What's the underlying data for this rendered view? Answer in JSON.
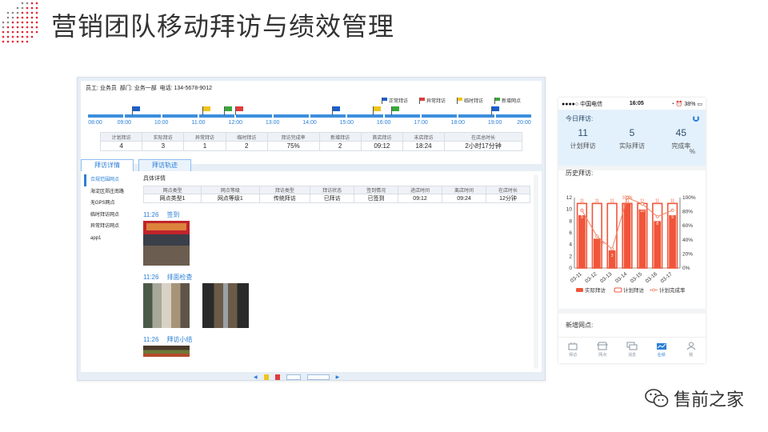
{
  "slide": {
    "title": "营销团队移动拜访与绩效管理",
    "brand": "售前之家"
  },
  "desktop": {
    "employee": {
      "label_employee": "员工:",
      "employee": "业务员",
      "label_dept": "部门:",
      "dept": "业务一部",
      "label_phone": "电话:",
      "phone": "134-5678-9012"
    },
    "legend": [
      {
        "label": "正常拜访",
        "color": "#1a5fc9"
      },
      {
        "label": "异常拜访",
        "color": "#e23b3b"
      },
      {
        "label": "临时拜访",
        "color": "#f0c419"
      },
      {
        "label": "新增网点",
        "color": "#3aa83a"
      }
    ],
    "timeline": {
      "labels": [
        "08:00",
        "09:00",
        "10:00",
        "11:00",
        "12:00",
        "13:00",
        "14:00",
        "15:00",
        "16:00",
        "17:00",
        "18:00",
        "19:00",
        "20:00"
      ],
      "flags": [
        {
          "hour": 9.2,
          "color": "#1a5fc9"
        },
        {
          "hour": 11.1,
          "color": "#f0c419"
        },
        {
          "hour": 11.7,
          "color": "#3aa83a"
        },
        {
          "hour": 12.0,
          "color": "#e23b3b"
        },
        {
          "hour": 14.6,
          "color": "#1a5fc9"
        },
        {
          "hour": 15.7,
          "color": "#f0c419"
        },
        {
          "hour": 16.2,
          "color": "#3aa83a"
        },
        {
          "hour": 18.9,
          "color": "#1a5fc9"
        }
      ]
    },
    "stats": {
      "headers": [
        "计划拜访",
        "实际拜访",
        "异常拜访",
        "临时拜访",
        "拜访完成率",
        "新增拜访",
        "首店拜访",
        "末店拜访",
        "在店总时长"
      ],
      "values": [
        "4",
        "3",
        "1",
        "2",
        "75%",
        "2",
        "09:12",
        "18:24",
        "2小时17分钟"
      ]
    },
    "tabs": [
      "拜访详情",
      "拜访轨迹"
    ],
    "side_items": [
      "合规范围网点",
      "海淀区郑庄南路",
      "无GPS网点",
      "临时拜访网点",
      "异常拜访网点",
      "app1"
    ],
    "detail": {
      "label": "具体详情",
      "headers": [
        "网点类型",
        "网点等级",
        "拜访类型",
        "拜访状态",
        "签到情况",
        "进店时间",
        "离店时间",
        "在店时长"
      ],
      "row": [
        "网点类型1",
        "网点等级1",
        "传统拜访",
        "已拜访",
        "已签到",
        "09:12",
        "09:24",
        "12分钟"
      ]
    },
    "entries": [
      {
        "time": "11:26",
        "action": "签到"
      },
      {
        "time": "11:26",
        "action": "排面检查"
      },
      {
        "time": "11:26",
        "action": "拜访小结"
      }
    ]
  },
  "mobile": {
    "status": {
      "carrier": "●●●●○ 中国电信",
      "time": "16:05",
      "battery": "38%"
    },
    "today_title": "今日拜访:",
    "kpis": [
      {
        "value": "11",
        "label": "计划拜访"
      },
      {
        "value": "5",
        "label": "实际拜访"
      },
      {
        "value": "45",
        "label": "完成率"
      }
    ],
    "kpi_unit": "%",
    "history_title": "历史拜访:",
    "new_title": "新增网点:",
    "tabbar": [
      "拜访",
      "网点",
      "消息",
      "业绩",
      "我"
    ],
    "colors": {
      "actual": "#f0553a",
      "plan": "#f0553a",
      "accent": "#2c7fd5"
    }
  },
  "chart_data": {
    "type": "bar",
    "categories": [
      "03-11",
      "03-12",
      "03-13",
      "03-14",
      "03-15",
      "03-16",
      "03-17"
    ],
    "series": [
      {
        "name": "实际拜访",
        "values": [
          9,
          5,
          3,
          11,
          10,
          8,
          9
        ]
      },
      {
        "name": "计划拜访",
        "values": [
          11,
          11,
          11,
          11,
          11,
          11,
          11
        ]
      },
      {
        "name": "计划完成率",
        "values": [
          82,
          45,
          27,
          100,
          91,
          73,
          82
        ]
      }
    ],
    "point_labels": [
      "9",
      "45%",
      "3",
      "100%",
      "10",
      "8",
      "9"
    ],
    "yticks": [
      0,
      2,
      4,
      6,
      8,
      10,
      12
    ],
    "y2ticks": [
      "0%",
      "20%",
      "40%",
      "60%",
      "80%",
      "100%"
    ],
    "ylim": [
      0,
      12
    ],
    "y2lim": [
      0,
      100
    ],
    "legend_position": "bottom",
    "grid": false
  }
}
